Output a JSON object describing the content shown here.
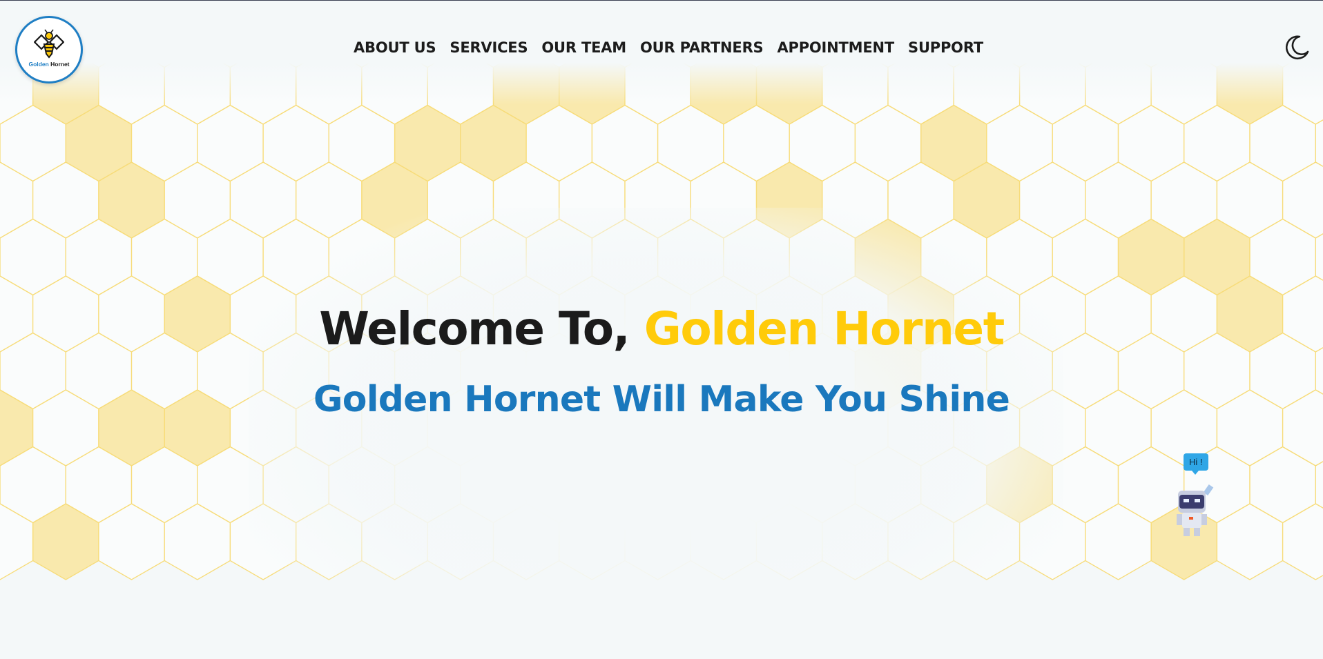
{
  "brand": {
    "name_part1": "Golden",
    "name_part2": "Hornet",
    "colors": {
      "gold": "#ffcb0a",
      "blue": "#1a78bd",
      "dark": "#1b1b1b",
      "background": "#f4f8f9"
    },
    "logo_icon": "hornet-logo-icon"
  },
  "nav": {
    "items": [
      {
        "label": "ABOUT US"
      },
      {
        "label": "SERVICES"
      },
      {
        "label": "OUR TEAM"
      },
      {
        "label": "OUR PARTNERS"
      },
      {
        "label": "APPOINTMENT"
      },
      {
        "label": "SUPPORT"
      }
    ]
  },
  "theme_toggle": {
    "icon": "moon-icon"
  },
  "hero": {
    "title_prefix": "Welcome To,",
    "title_accent": "Golden Hornet",
    "subtitle": "Golden Hornet Will Make You Shine"
  },
  "chat_bot": {
    "greeting": "Hi !",
    "icon": "robot-mascot-icon"
  }
}
